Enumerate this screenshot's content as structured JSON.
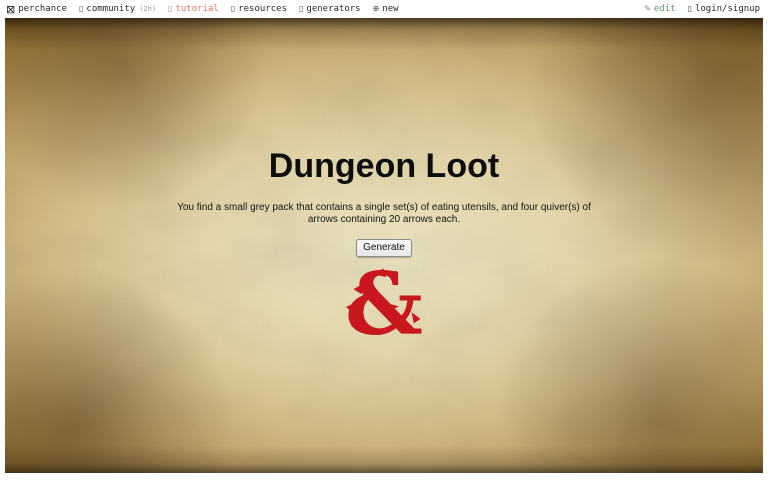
{
  "navbar": {
    "brand": {
      "label": "perchance",
      "icon": "⊠"
    },
    "items": [
      {
        "label": "community",
        "suffix": "(2h)",
        "icon": "▯"
      },
      {
        "label": "tutorial",
        "icon": "▯"
      },
      {
        "label": "resources",
        "icon": "▯"
      },
      {
        "label": "generators",
        "icon": "▯"
      },
      {
        "label": "new",
        "icon": "⊕"
      }
    ],
    "edit": {
      "label": "edit",
      "icon": "✎"
    },
    "login": {
      "label": "login/signup",
      "icon": "▯"
    }
  },
  "generator": {
    "title": "Dungeon Loot",
    "result": "You find a small grey pack that contains a single set(s) of eating utensils, and four quiver(s) of arrows containing 20 arrows each.",
    "generate_label": "Generate",
    "logo_name": "dnd-ampersand-dragon-logo"
  },
  "colors": {
    "tutorial_orange": "#e0795a",
    "edit_green": "#5e9b6a",
    "logo_red": "#c9171f",
    "parchment_light": "#f2e9c6",
    "parchment_dark": "#2b1d08"
  }
}
